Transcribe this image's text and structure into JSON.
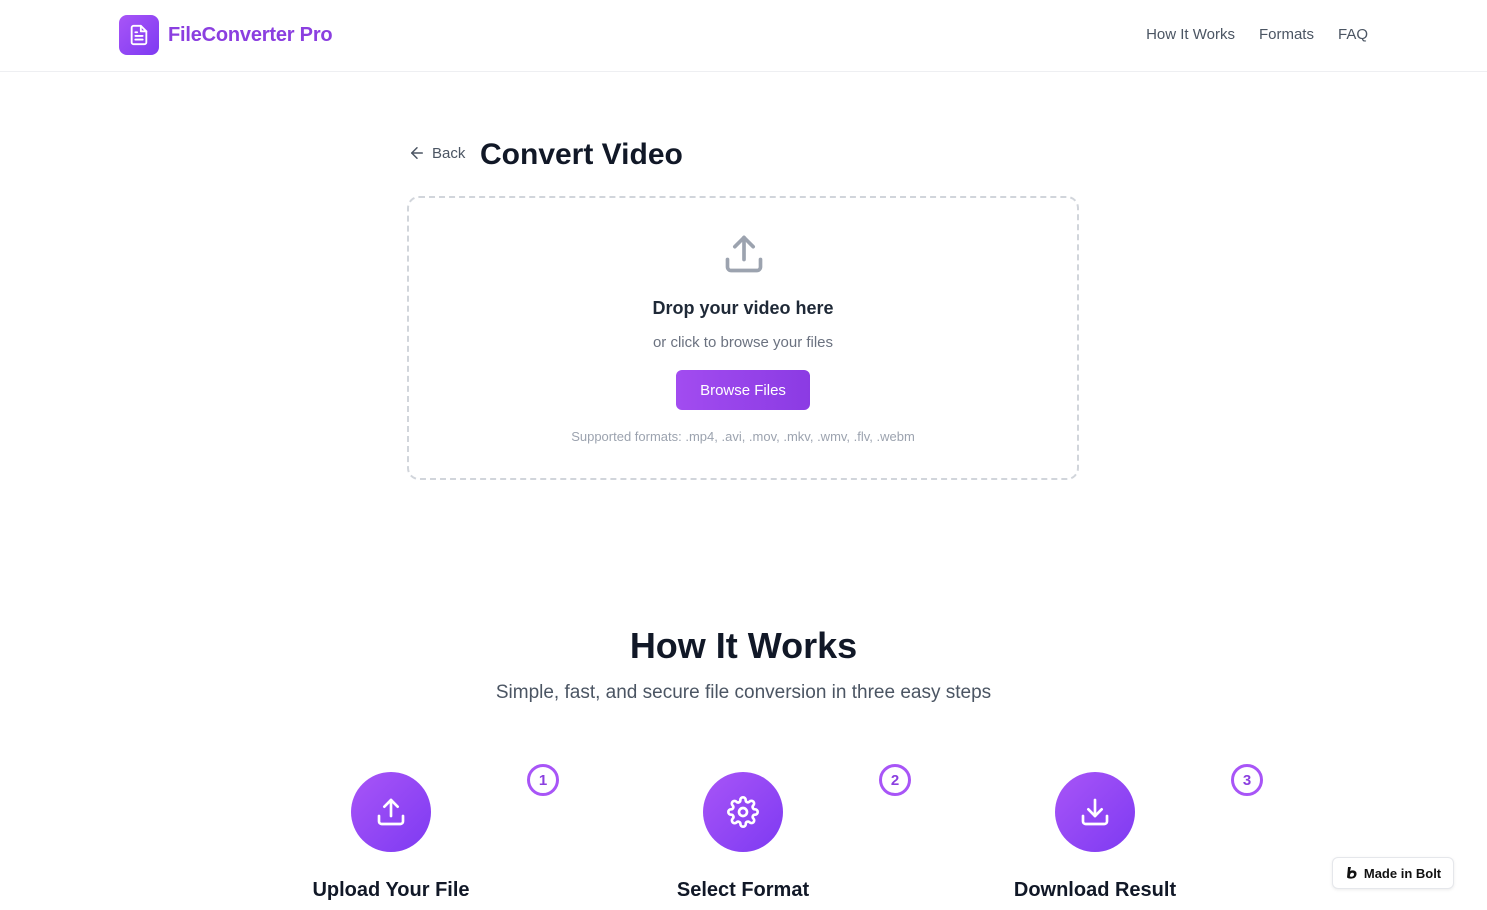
{
  "brand": {
    "name": "FileConverter Pro",
    "icon": "file-text-icon",
    "color": "#8b3fe0"
  },
  "nav": {
    "items": [
      "How It Works",
      "Formats",
      "FAQ"
    ]
  },
  "convert": {
    "back_label": "Back",
    "title": "Convert Video",
    "dropzone": {
      "icon": "upload-icon",
      "title": "Drop your video here",
      "subtitle": "or click to browse your files",
      "button_label": "Browse Files",
      "formats": "Supported formats: .mp4, .avi, .mov, .mkv, .wmv, .flv, .webm"
    }
  },
  "how_it_works": {
    "title": "How It Works",
    "subtitle": "Simple, fast, and secure file conversion in three easy steps",
    "steps": [
      {
        "number": "1",
        "title": "Upload Your File",
        "icon": "upload-icon"
      },
      {
        "number": "2",
        "title": "Select Format",
        "icon": "gear-icon"
      },
      {
        "number": "3",
        "title": "Download Result",
        "icon": "download-icon"
      }
    ]
  },
  "badge": {
    "label": "Made in Bolt",
    "icon": "bolt-logo-icon"
  },
  "colors": {
    "accent": "#a855f7",
    "accent_dark": "#7e3af2",
    "text": "#111827",
    "muted": "#6b7280"
  }
}
